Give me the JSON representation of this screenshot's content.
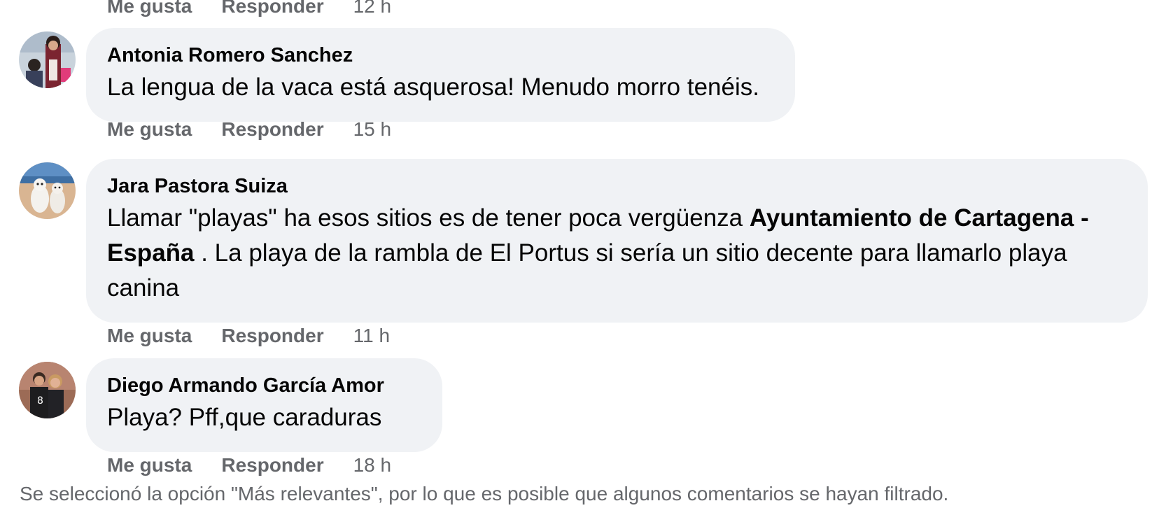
{
  "comments": [
    {
      "actions": {
        "like": "Me gusta",
        "reply": "Responder",
        "time": "12 h"
      }
    },
    {
      "author": "Antonia Romero Sanchez",
      "text": "La lengua de la vaca está asquerosa! Menudo morro tenéis.",
      "actions": {
        "like": "Me gusta",
        "reply": "Responder",
        "time": "15 h"
      }
    },
    {
      "author": "Jara Pastora Suiza",
      "text_before": "Llamar \"playas\" ha esos sitios es de tener poca vergüenza ",
      "mention": "Ayuntamiento de Cartagena - España",
      "text_after": " . La playa de la rambla de El Portus si sería un sitio decente para llamarlo playa canina",
      "actions": {
        "like": "Me gusta",
        "reply": "Responder",
        "time": "11 h"
      }
    },
    {
      "author": "Diego Armando García Amor",
      "text": "Playa? Pff,que caraduras",
      "actions": {
        "like": "Me gusta",
        "reply": "Responder",
        "time": "18 h"
      }
    }
  ],
  "footer_note": "Se seleccionó la opción \"Más relevantes\", por lo que es posible que algunos comentarios se hayan filtrado.",
  "colors": {
    "bubble_bg": "#f0f2f5",
    "secondary_text": "#65676b",
    "primary_text": "#050505"
  }
}
